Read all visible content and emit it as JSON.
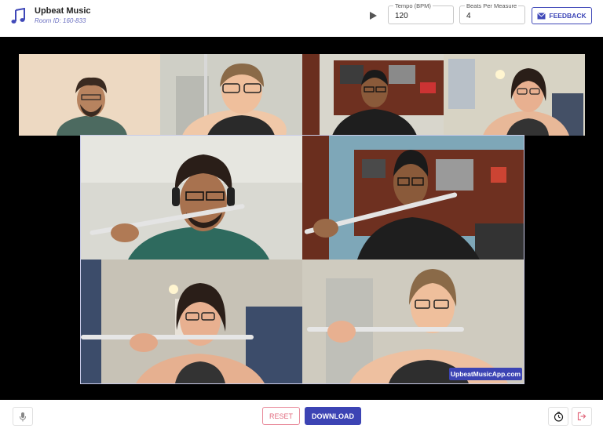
{
  "header": {
    "app_title": "Upbeat Music",
    "room_id": "Room ID: 160-833",
    "logo_icon": "music-note-icon",
    "play_icon": "play-icon"
  },
  "tempo": {
    "label": "Tempo (BPM)",
    "value": "120"
  },
  "beats": {
    "label": "Beats Per Measure",
    "value": "4"
  },
  "feedback": {
    "label": "FEEDBACK",
    "icon": "mail-icon"
  },
  "video": {
    "watermark": "UpbeatMusicApp.com",
    "participants": [
      {
        "slot": "top-1",
        "desc": "man with beard"
      },
      {
        "slot": "top-2",
        "desc": "woman with glasses and flute"
      },
      {
        "slot": "top-3",
        "desc": "man with earphones"
      },
      {
        "slot": "top-4",
        "desc": "woman with glasses"
      },
      {
        "slot": "main-1",
        "desc": "man with headphones playing flute"
      },
      {
        "slot": "main-2",
        "desc": "man with earphones playing flute"
      },
      {
        "slot": "main-3",
        "desc": "woman with glasses playing flute"
      },
      {
        "slot": "main-4",
        "desc": "woman with glasses playing flute"
      }
    ]
  },
  "footer": {
    "mic_icon": "microphone-icon",
    "reset_label": "RESET",
    "download_label": "DOWNLOAD",
    "metronome_icon": "metronome-icon",
    "exit_icon": "exit-icon"
  },
  "colors": {
    "accent": "#3c44b4",
    "reset": "#e26a7e",
    "stage": "#000000"
  }
}
